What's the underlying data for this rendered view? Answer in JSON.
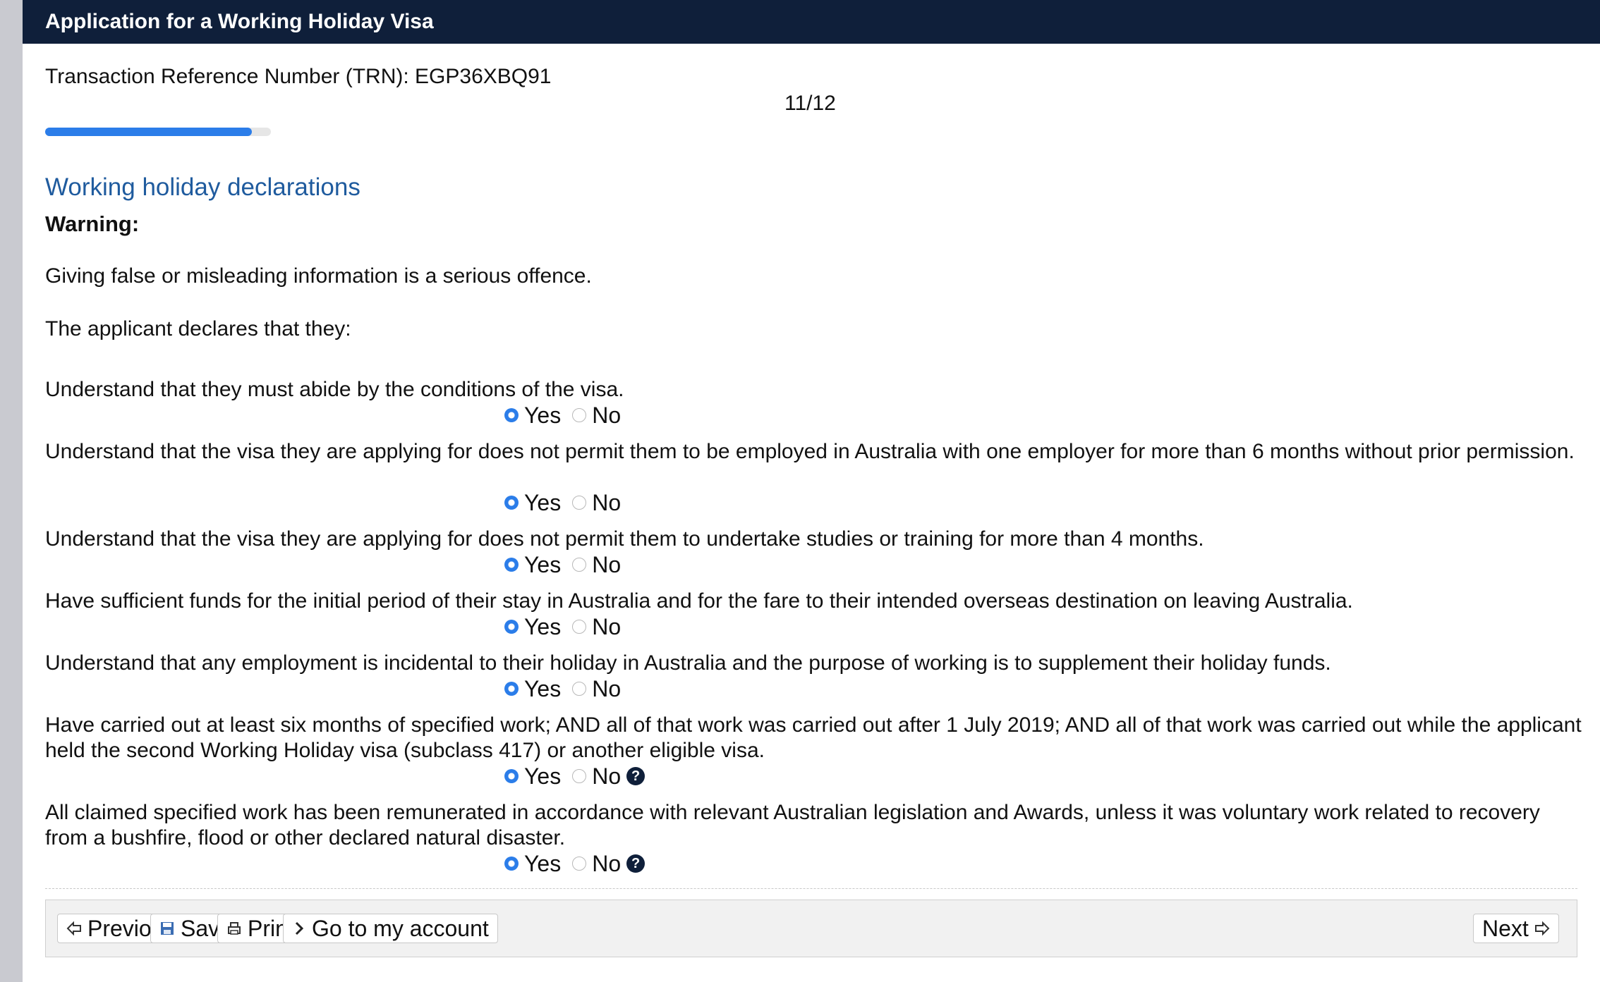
{
  "header": {
    "title": "Application for a Working Holiday Visa"
  },
  "trn": "Transaction Reference Number (TRN): EGP36XBQ91",
  "page_indicator": "11/12",
  "progress": {
    "fraction": 0.917,
    "color": "#2b7de9"
  },
  "section": {
    "heading": "Working holiday declarations",
    "warning_label": "Warning:",
    "warning_text": "Giving false or misleading information is a serious offence.",
    "intro": "The applicant declares that they:"
  },
  "options": {
    "yes": "Yes",
    "no": "No"
  },
  "questions": [
    {
      "text": "Understand that they must abide by the conditions of the visa.",
      "selected": "Yes",
      "help": false
    },
    {
      "text": "Understand that the visa they are applying for does not permit them to be employed in Australia with one employer for more than 6 months without prior permission.",
      "selected": "Yes",
      "help": false
    },
    {
      "text": "Understand that the visa they are applying for does not permit them to undertake studies or training for more than 4 months.",
      "selected": "Yes",
      "help": false
    },
    {
      "text": "Have sufficient funds for the initial period of their stay in Australia and for the fare to their intended overseas destination on leaving Australia.",
      "selected": "Yes",
      "help": false
    },
    {
      "text": "Understand that any employment is incidental to their holiday in Australia and the purpose of working is to supplement their holiday funds.",
      "selected": "Yes",
      "help": false
    },
    {
      "text": "Have carried out at least six months of specified work; AND all of that work was carried out after 1 July 2019; AND all of that work was carried out while the applicant held the second Working Holiday visa (subclass 417) or another eligible visa.",
      "selected": "Yes",
      "help": true
    },
    {
      "text": "All claimed specified work has been remunerated in accordance with relevant Australian legislation and Awards, unless it was voluntary work related to recovery from a bushfire, flood or other declared natural disaster.",
      "selected": "Yes",
      "help": true
    }
  ],
  "footer": {
    "previous": "Previous",
    "save": "Save",
    "print": "Print",
    "account": "Go to my account",
    "next": "Next"
  },
  "icons": {
    "previous": "arrow-left-icon",
    "save": "floppy-disk-icon",
    "print": "printer-icon",
    "account": "chevron-right-icon",
    "next": "arrow-right-icon",
    "help": "help-question-icon"
  },
  "colors": {
    "header_bg": "#0f1f3a",
    "heading": "#1f5b9e",
    "accent": "#2b7de9"
  }
}
